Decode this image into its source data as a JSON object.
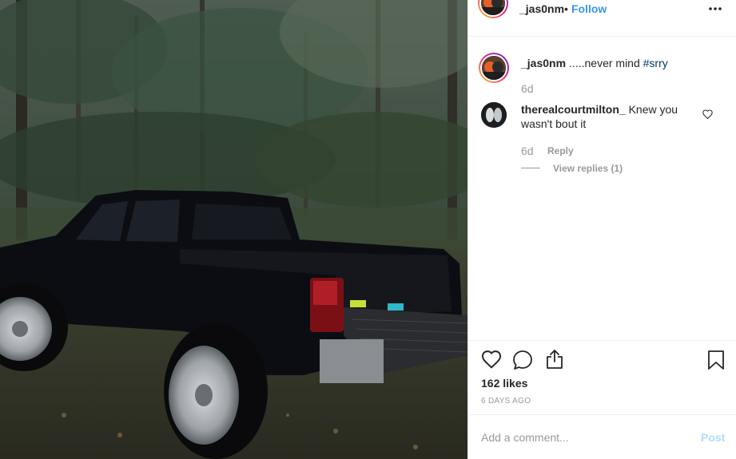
{
  "post": {
    "username": "_jas0nm",
    "dot": "•",
    "follow_label": "Follow",
    "more_label": "•••",
    "photo_alt": "black-pickup-truck-in-forest",
    "caption": {
      "username": "_jas0nm",
      "text": ".....never mind ",
      "hashtag": "#srry"
    },
    "caption_time": "6d",
    "comments": [
      {
        "username": "therealcourtmilton_",
        "text": " Knew you wasn't bout it",
        "time": "6d",
        "reply_label": "Reply",
        "view_replies_label": "View replies (1)"
      }
    ],
    "likes_label": "162 likes",
    "date_label": "6 DAYS AGO",
    "add_comment_placeholder": "Add a comment...",
    "post_label": "Post"
  },
  "colors": {
    "link_blue": "#3897f0",
    "hashtag": "#003569",
    "muted": "#999999",
    "post_disabled": "#b3dbff"
  },
  "icons": [
    "more-icon",
    "heart-icon",
    "comment-icon",
    "share-icon",
    "bookmark-icon",
    "like-comment-icon"
  ]
}
